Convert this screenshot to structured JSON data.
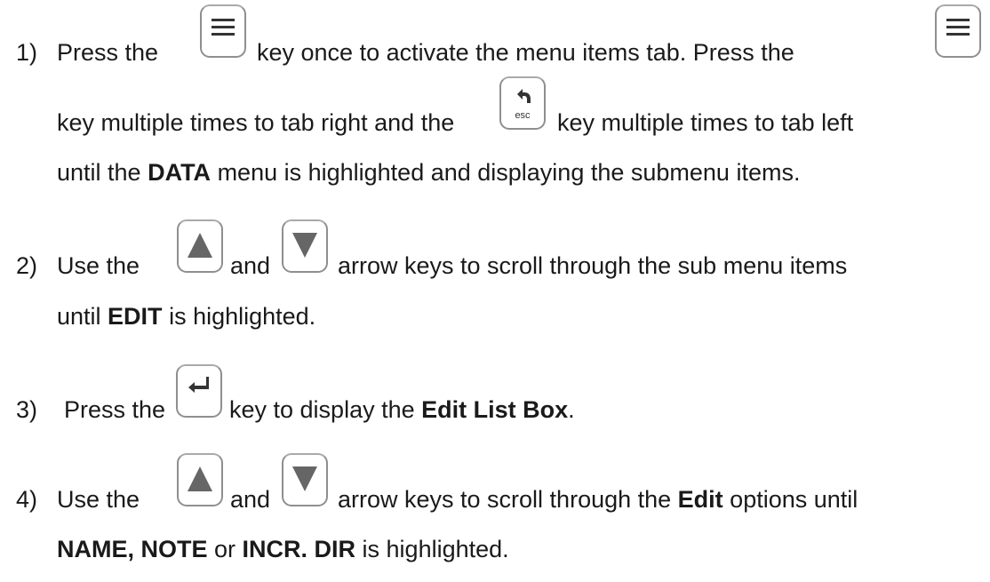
{
  "steps": [
    {
      "number": "1)",
      "lines": [
        {
          "segments": [
            "Press the",
            "key once to activate the menu items tab.  Press the"
          ]
        },
        {
          "segments": [
            "key multiple times to tab right and the",
            "key multiple times to tab left"
          ]
        },
        {
          "pre": "until the ",
          "bold": "DATA",
          "post": " menu is highlighted and displaying the submenu items."
        }
      ]
    },
    {
      "number": "2)",
      "lines": [
        {
          "segments": [
            "Use the",
            "and",
            "arrow keys to scroll through the sub menu items"
          ]
        },
        {
          "pre": "until ",
          "bold": "EDIT",
          "post": " is highlighted."
        }
      ]
    },
    {
      "number": "3)",
      "lines": [
        {
          "segments": [
            "Press the",
            "key to display the "
          ],
          "bold": "Edit List Box",
          "post": "."
        }
      ]
    },
    {
      "number": "4)",
      "lines": [
        {
          "segments": [
            "Use the",
            "and",
            "arrow keys to scroll through the "
          ],
          "bold": "Edit",
          "post": " options until"
        },
        {
          "bold1": "NAME, NOTE",
          "mid": " or ",
          "bold2": "INCR. DIR",
          "post": " is highlighted."
        }
      ]
    }
  ],
  "keys": {
    "menu": "menu-icon",
    "esc": {
      "icon": "back-arrow-icon",
      "label": "esc"
    },
    "up": "up-triangle-icon",
    "down": "down-triangle-icon",
    "enter": "enter-arrow-icon"
  },
  "colors": {
    "text": "#1a1a1a",
    "key_border": "#8f8f8f",
    "key_glyph": "#333333",
    "arrow_glyph": "#666666"
  }
}
